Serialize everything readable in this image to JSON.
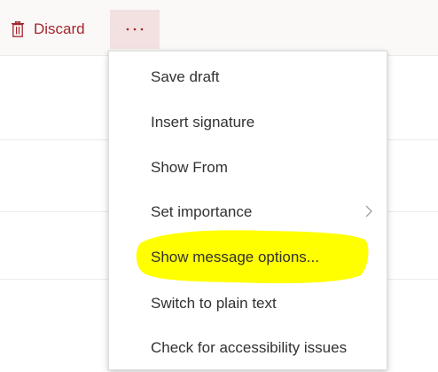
{
  "toolbar": {
    "discard_label": "Discard",
    "more_label": "···"
  },
  "menu": {
    "items": [
      {
        "label": "Save draft"
      },
      {
        "label": "Insert signature"
      },
      {
        "label": "Show From"
      },
      {
        "label": "Set importance",
        "has_submenu": true
      },
      {
        "label": "Show message options...",
        "highlighted": true
      },
      {
        "label": "Switch to plain text"
      },
      {
        "label": "Check for accessibility issues"
      }
    ]
  },
  "colors": {
    "accent": "#a4262c",
    "highlight": "#ffff00",
    "menu_text": "#323130"
  }
}
